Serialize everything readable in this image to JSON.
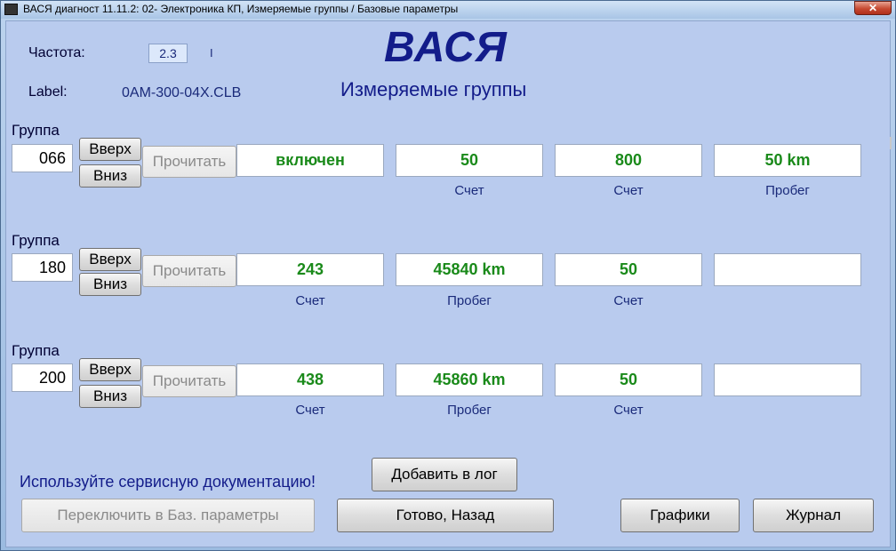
{
  "window": {
    "title": "ВАСЯ диагност 11.11.2: 02- Электроника КП,  Измеряемые группы / Базовые параметры",
    "close_glyph": "✕"
  },
  "header": {
    "freq_label": "Частота:",
    "freq_value": "2.3",
    "freq_indicator": "I",
    "label_label": "Label:",
    "label_value": "0AM-300-04X.CLB",
    "app_name": "ВАСЯ",
    "subtitle": "Измеряемые группы"
  },
  "groups": [
    {
      "label": "Группа",
      "number": "066",
      "up_label": "Вверх",
      "down_label": "Вниз",
      "read_label": "Прочитать",
      "values": [
        "включен",
        "50",
        "800",
        "50 km"
      ],
      "units": [
        "",
        "Счет",
        "Счет",
        "Пробег"
      ]
    },
    {
      "label": "Группа",
      "number": "180",
      "up_label": "Вверх",
      "down_label": "Вниз",
      "read_label": "Прочитать",
      "values": [
        "243",
        "45840 km",
        "50",
        ""
      ],
      "units": [
        "Счет",
        "Пробег",
        "Счет",
        ""
      ]
    },
    {
      "label": "Группа",
      "number": "200",
      "up_label": "Вверх",
      "down_label": "Вниз",
      "read_label": "Прочитать",
      "values": [
        "438",
        "45860 km",
        "50",
        ""
      ],
      "units": [
        "Счет",
        "Пробег",
        "Счет",
        ""
      ]
    }
  ],
  "footer": {
    "hint": "Используйте сервисную документацию!",
    "add_log_label": "Добавить в лог",
    "switch_label": "Переключить в Баз. параметры",
    "done_label": "Готово, Назад",
    "graphs_label": "Графики",
    "journal_label": "Журнал"
  },
  "colors": {
    "background": "#b9cbee",
    "value_text": "#1a8a1a",
    "title_text": "#131c8a"
  }
}
